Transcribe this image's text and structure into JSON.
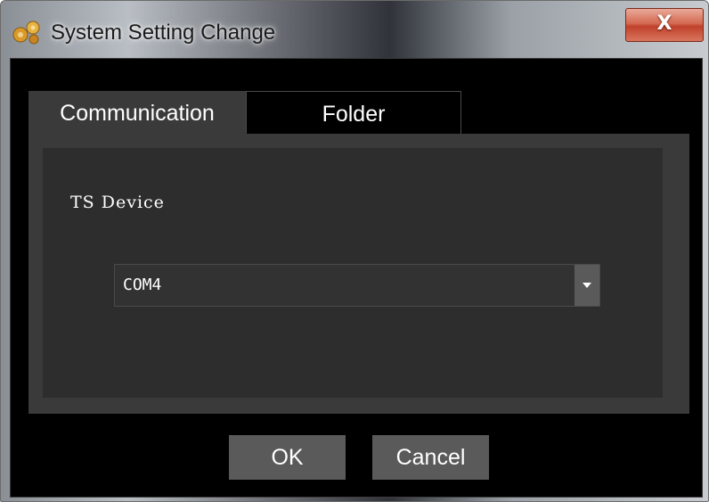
{
  "window": {
    "title": "System Setting Change",
    "close_symbol": "X"
  },
  "tabs": [
    {
      "label": "Communication",
      "selected": true
    },
    {
      "label": "Folder",
      "selected": false
    }
  ],
  "communication": {
    "device_label": "TS Device",
    "device_select": {
      "value": "COM4"
    }
  },
  "buttons": {
    "ok_label": "OK",
    "cancel_label": "Cancel"
  },
  "icons": {
    "app": "app-gear-icon",
    "dropdown": "chevron-down-icon"
  },
  "colors": {
    "client_bg": "#000000",
    "panel_bg": "#3a3a3a",
    "inner_panel_bg": "#2d2d2d",
    "button_bg": "#5a5a5a",
    "close_button": "#c0412b"
  }
}
